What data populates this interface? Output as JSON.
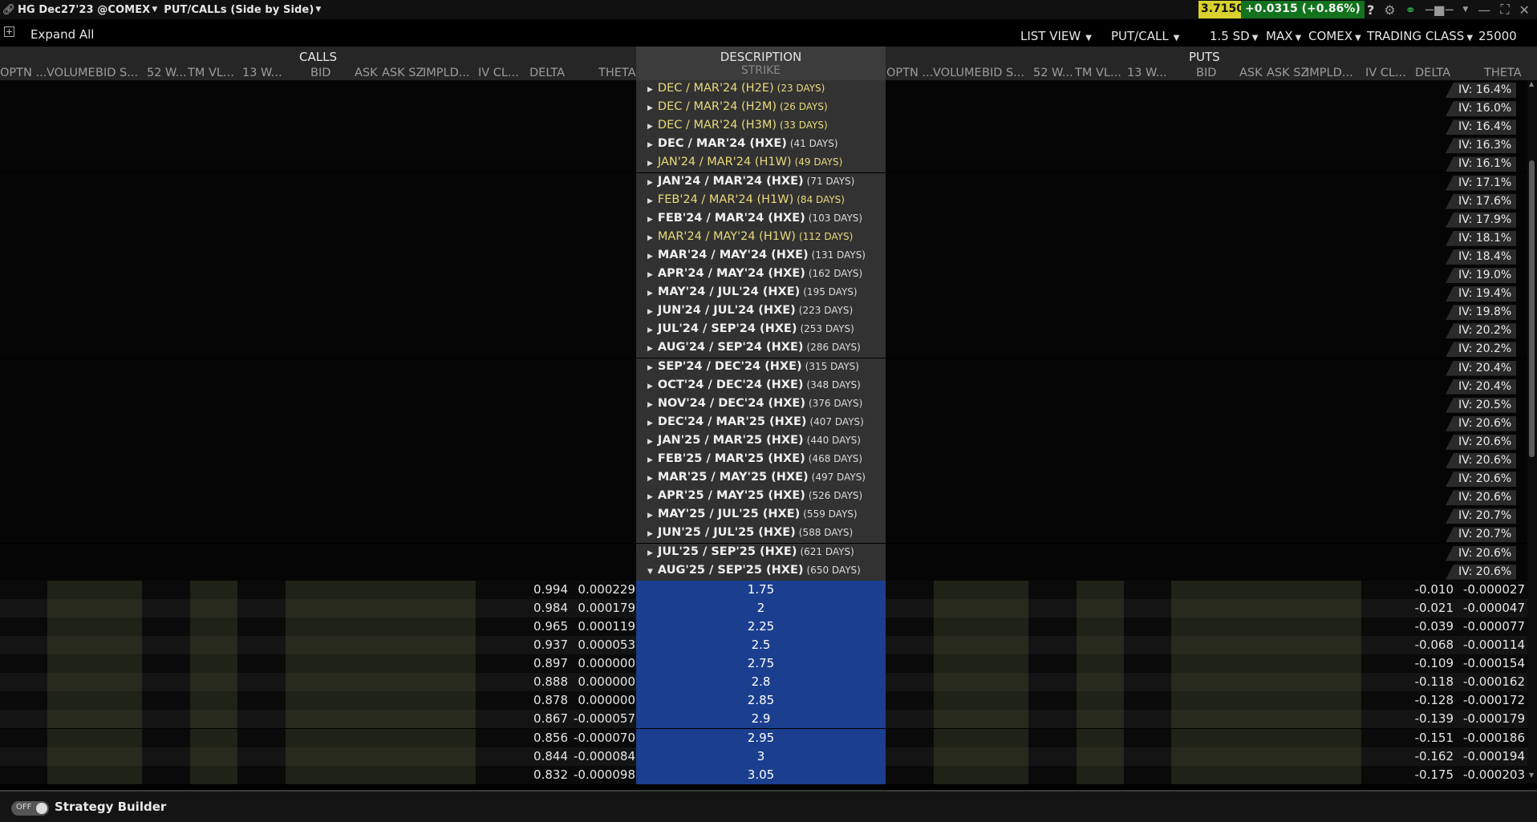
{
  "window": {
    "title": "HG Dec27'23 @COMEX",
    "view_title": "PUT/CALLs (Side by Side)",
    "last_price": "3.7150",
    "change": "+0.0315 (+0.86%)",
    "icons": [
      "help-icon",
      "settings-icon",
      "link-icon",
      "pin-icon",
      "minimize-icon",
      "maximize-icon",
      "close-icon"
    ],
    "help_glyph": "?"
  },
  "toolbar": {
    "expand_all": "Expand All",
    "list_view": "LIST VIEW",
    "put_call": "PUT/CALL",
    "sd": "1.5 SD",
    "max": "MAX",
    "exchange": "COMEX",
    "trading_class": "TRADING CLASS",
    "multiplier": "25000"
  },
  "header": {
    "calls": "CALLS",
    "puts": "PUTS",
    "description": "DESCRIPTION",
    "strike": "STRIKE",
    "call_columns": [
      "OPTN ...",
      "VOLUME",
      "BID S...",
      "52 W...",
      "TM VL...",
      "13 W...",
      "BID",
      "ASK",
      "ASK SZ",
      "IMPLD...",
      "IV CL...",
      "DELTA",
      "THETA"
    ],
    "put_columns": [
      "OPTN ...",
      "VOLUME",
      "BID S...",
      "52 W...",
      "TM VL...",
      "13 W...",
      "BID",
      "ASK",
      "ASK SZ",
      "IMPLD...",
      "IV CL...",
      "DELTA",
      "THETA"
    ]
  },
  "expiries": [
    {
      "name": "DEC / MAR'24 (H2E)",
      "days": "(23 DAYS)",
      "iv": "IV: 16.4%",
      "weekly": true
    },
    {
      "name": "DEC / MAR'24 (H2M)",
      "days": "(26 DAYS)",
      "iv": "IV: 16.0%",
      "weekly": true
    },
    {
      "name": "DEC / MAR'24 (H3M)",
      "days": "(33 DAYS)",
      "iv": "IV: 16.4%",
      "weekly": true
    },
    {
      "name": "DEC / MAR'24 (HXE)",
      "days": "(41 DAYS)",
      "iv": "IV: 16.3%",
      "weekly": false
    },
    {
      "name": "JAN'24 / MAR'24 (H1W)",
      "days": "(49 DAYS)",
      "iv": "IV: 16.1%",
      "weekly": true
    },
    {
      "name": "JAN'24 / MAR'24 (HXE)",
      "days": "(71 DAYS)",
      "iv": "IV: 17.1%",
      "weekly": false
    },
    {
      "name": "FEB'24 / MAR'24 (H1W)",
      "days": "(84 DAYS)",
      "iv": "IV: 17.6%",
      "weekly": true
    },
    {
      "name": "FEB'24 / MAR'24 (HXE)",
      "days": "(103 DAYS)",
      "iv": "IV: 17.9%",
      "weekly": false
    },
    {
      "name": "MAR'24 / MAY'24 (H1W)",
      "days": "(112 DAYS)",
      "iv": "IV: 18.1%",
      "weekly": true
    },
    {
      "name": "MAR'24 / MAY'24 (HXE)",
      "days": "(131 DAYS)",
      "iv": "IV: 18.4%",
      "weekly": false
    },
    {
      "name": "APR'24 / MAY'24 (HXE)",
      "days": "(162 DAYS)",
      "iv": "IV: 19.0%",
      "weekly": false
    },
    {
      "name": "MAY'24 / JUL'24 (HXE)",
      "days": "(195 DAYS)",
      "iv": "IV: 19.4%",
      "weekly": false
    },
    {
      "name": "JUN'24 / JUL'24 (HXE)",
      "days": "(223 DAYS)",
      "iv": "IV: 19.8%",
      "weekly": false
    },
    {
      "name": "JUL'24 / SEP'24 (HXE)",
      "days": "(253 DAYS)",
      "iv": "IV: 20.2%",
      "weekly": false
    },
    {
      "name": "AUG'24 / SEP'24 (HXE)",
      "days": "(286 DAYS)",
      "iv": "IV: 20.2%",
      "weekly": false
    },
    {
      "name": "SEP'24 / DEC'24 (HXE)",
      "days": "(315 DAYS)",
      "iv": "IV: 20.4%",
      "weekly": false
    },
    {
      "name": "OCT'24 / DEC'24 (HXE)",
      "days": "(348 DAYS)",
      "iv": "IV: 20.4%",
      "weekly": false
    },
    {
      "name": "NOV'24 / DEC'24 (HXE)",
      "days": "(376 DAYS)",
      "iv": "IV: 20.5%",
      "weekly": false
    },
    {
      "name": "DEC'24 / MAR'25 (HXE)",
      "days": "(407 DAYS)",
      "iv": "IV: 20.6%",
      "weekly": false
    },
    {
      "name": "JAN'25 / MAR'25 (HXE)",
      "days": "(440 DAYS)",
      "iv": "IV: 20.6%",
      "weekly": false
    },
    {
      "name": "FEB'25 / MAR'25 (HXE)",
      "days": "(468 DAYS)",
      "iv": "IV: 20.6%",
      "weekly": false
    },
    {
      "name": "MAR'25 / MAY'25 (HXE)",
      "days": "(497 DAYS)",
      "iv": "IV: 20.6%",
      "weekly": false
    },
    {
      "name": "APR'25 / MAY'25 (HXE)",
      "days": "(526 DAYS)",
      "iv": "IV: 20.6%",
      "weekly": false
    },
    {
      "name": "MAY'25 / JUL'25 (HXE)",
      "days": "(559 DAYS)",
      "iv": "IV: 20.7%",
      "weekly": false
    },
    {
      "name": "JUN'25 / JUL'25 (HXE)",
      "days": "(588 DAYS)",
      "iv": "IV: 20.7%",
      "weekly": false
    },
    {
      "name": "JUL'25 / SEP'25 (HXE)",
      "days": "(621 DAYS)",
      "iv": "IV: 20.6%",
      "weekly": false
    },
    {
      "name": "AUG'25 / SEP'25 (HXE)",
      "days": "(650 DAYS)",
      "iv": "IV: 20.6%",
      "weekly": false,
      "expanded": true
    }
  ],
  "strikes": [
    {
      "strike": "1.75",
      "call_delta": "0.994",
      "call_theta": "0.000229",
      "put_delta": "-0.010",
      "put_theta": "-0.000027"
    },
    {
      "strike": "2",
      "call_delta": "0.984",
      "call_theta": "0.000179",
      "put_delta": "-0.021",
      "put_theta": "-0.000047"
    },
    {
      "strike": "2.25",
      "call_delta": "0.965",
      "call_theta": "0.000119",
      "put_delta": "-0.039",
      "put_theta": "-0.000077"
    },
    {
      "strike": "2.5",
      "call_delta": "0.937",
      "call_theta": "0.000053",
      "put_delta": "-0.068",
      "put_theta": "-0.000114"
    },
    {
      "strike": "2.75",
      "call_delta": "0.897",
      "call_theta": "0.000000",
      "put_delta": "-0.109",
      "put_theta": "-0.000154"
    },
    {
      "strike": "2.8",
      "call_delta": "0.888",
      "call_theta": "0.000000",
      "put_delta": "-0.118",
      "put_theta": "-0.000162"
    },
    {
      "strike": "2.85",
      "call_delta": "0.878",
      "call_theta": "0.000000",
      "put_delta": "-0.128",
      "put_theta": "-0.000172"
    },
    {
      "strike": "2.9",
      "call_delta": "0.867",
      "call_theta": "-0.000057",
      "put_delta": "-0.139",
      "put_theta": "-0.000179"
    },
    {
      "strike": "2.95",
      "call_delta": "0.856",
      "call_theta": "-0.000070",
      "put_delta": "-0.151",
      "put_theta": "-0.000186"
    },
    {
      "strike": "3",
      "call_delta": "0.844",
      "call_theta": "-0.000084",
      "put_delta": "-0.162",
      "put_theta": "-0.000194"
    },
    {
      "strike": "3.05",
      "call_delta": "0.832",
      "call_theta": "-0.000098",
      "put_delta": "-0.175",
      "put_theta": "-0.000203"
    }
  ],
  "footer": {
    "toggle_state": "OFF",
    "strategy_builder": "Strategy Builder"
  },
  "colors": {
    "price_bg": "#d9d22e",
    "change_bg": "#12721e",
    "weekly_text": "#e8da7a",
    "strike_bg": "#1b3f8e"
  }
}
